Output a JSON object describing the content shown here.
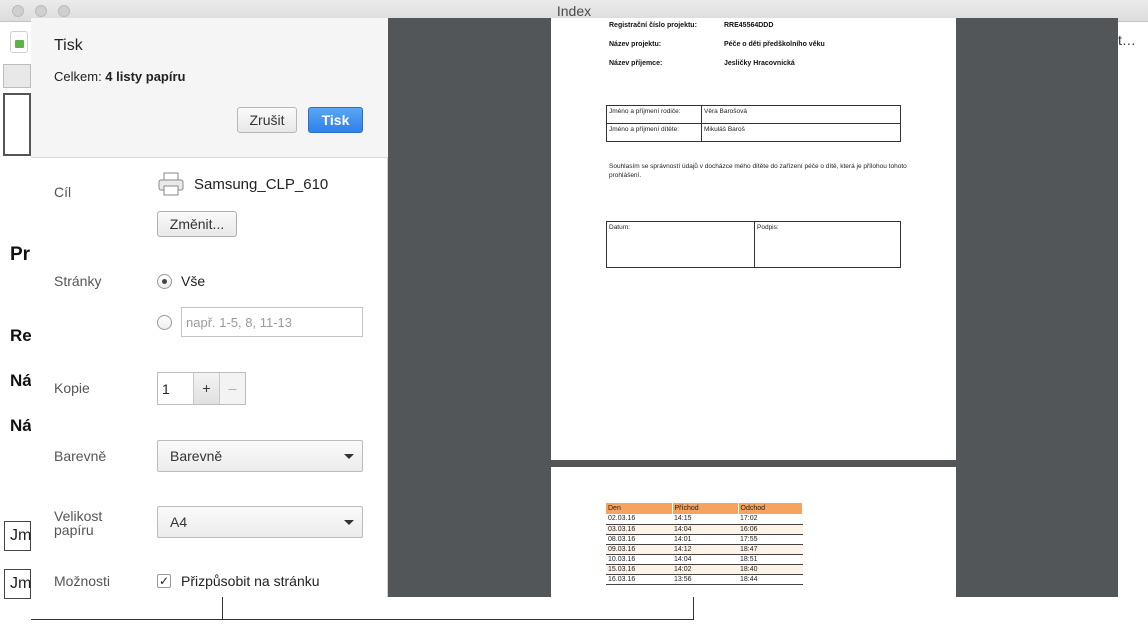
{
  "window": {
    "title": "Index"
  },
  "background_page": {
    "heading_fragment": "Pr",
    "row_fragments": [
      "Re",
      "Ná",
      "Ná"
    ],
    "cell_fragments": [
      "Jm",
      "Jm"
    ],
    "right_button_fragment": "t…"
  },
  "dialog": {
    "title": "Tisk",
    "summary_prefix": "Celkem: ",
    "summary_value": "4 listy papíru",
    "cancel_label": "Zrušit",
    "print_label": "Tisk",
    "destination": {
      "label": "Cíl",
      "printer_name": "Samsung_CLP_610",
      "change_label": "Změnit..."
    },
    "pages": {
      "label": "Stránky",
      "all_label": "Vše",
      "range_placeholder": "např. 1-5, 8, 11-13",
      "selected": "all"
    },
    "copies": {
      "label": "Kopie",
      "value": "1",
      "plus": "+",
      "minus": "–"
    },
    "color": {
      "label": "Barevně",
      "value": "Barevně"
    },
    "paper_size": {
      "label_line1": "Velikost",
      "label_line2": "papíru",
      "value": "A4"
    },
    "options": {
      "label": "Možnosti",
      "fit_label": "Přizpůsobit na stránku",
      "fit_checked": true,
      "check_glyph": "✓"
    }
  },
  "preview": {
    "page1": {
      "rows": [
        {
          "k": "Registrační číslo projektu:",
          "v": "RRE45564DDD"
        },
        {
          "k": "Název projektu:",
          "v": "Péče o děti předškolního věku"
        },
        {
          "k": "Název příjemce:",
          "v": "Jesličky Hracovnická"
        }
      ],
      "parent_label": "Jméno a příjmení rodiče:",
      "parent_value": "Věra Barošová",
      "child_label": "Jméno a příjmení dítěte:",
      "child_value": "Mikuláš Baroš",
      "declaration": "Souhlasím se správností údajů v docházce mého dítěte do zařízení péče o dítě, která je přílohou tohoto prohlášení.",
      "date_label": "Datum:",
      "signature_label": "Podpis:"
    },
    "page2": {
      "headers": [
        "Den",
        "Příchod",
        "Odchod"
      ],
      "rows": [
        [
          "02.03.16",
          "14:15",
          "17:02"
        ],
        [
          "03.03.16",
          "14:04",
          "16:06"
        ],
        [
          "08.03.16",
          "14:01",
          "17:55"
        ],
        [
          "09.03.16",
          "14:12",
          "18:47"
        ],
        [
          "10.03.16",
          "14:04",
          "18:51"
        ],
        [
          "15.03.16",
          "14:02",
          "18:40"
        ],
        [
          "16.03.16",
          "13:56",
          "18:44"
        ]
      ]
    }
  }
}
